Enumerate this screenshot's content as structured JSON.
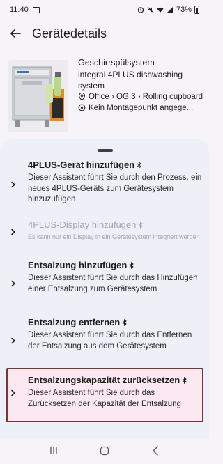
{
  "status_bar": {
    "time": "11:40",
    "battery": "73%"
  },
  "app_bar": {
    "title": "Gerätedetails"
  },
  "device": {
    "name": "Geschirrspülsystem",
    "model": "integral 4PLUS dishwashing system",
    "location": "Office › OG 3 › Rolling cupboard",
    "mounting": "Kein Montagepunkt angege..."
  },
  "actions": [
    {
      "title": "4PLUS-Gerät hinzufügen",
      "description": "Dieser Assistent führt Sie durch den Prozess, ein neues 4PLUS-Geräts zum Gerätesystem hinzuzufügen",
      "enabled": true
    },
    {
      "title": "4PLUS-Display hinzufügen",
      "description": "Es kann nur ein Display in ein Gerätesystem integriert werden",
      "enabled": false
    },
    {
      "title": "Entsalzung hinzufügen",
      "description": "Dieser Assistent führt Sie durch das Hinzufügen einer Entsalzung zum Gerätesystem",
      "enabled": true
    },
    {
      "title": "Entsalzung entfernen",
      "description": "Dieser Assistent führt Sie durch das Entfernen der Entsalzung aus dem Gerätesystem",
      "enabled": true
    },
    {
      "title": "Entsalzungskapazität zurücksetzen",
      "description": "Dieser Assistent führt Sie durch das Zurücksetzen der Kapazität der Entsalzung",
      "enabled": true,
      "highlighted": true
    }
  ],
  "colors": {
    "sheet": "#eef0f7",
    "highlight_border": "#7d3437",
    "highlight_fill": "#fbe8f0",
    "disabled": "#a5a6ad"
  },
  "icons": [
    "back-arrow-icon",
    "location-pin-icon",
    "target-icon",
    "chevron-right-icon",
    "bluetooth-icon",
    "recents-icon",
    "home-icon",
    "nav-back-icon"
  ]
}
